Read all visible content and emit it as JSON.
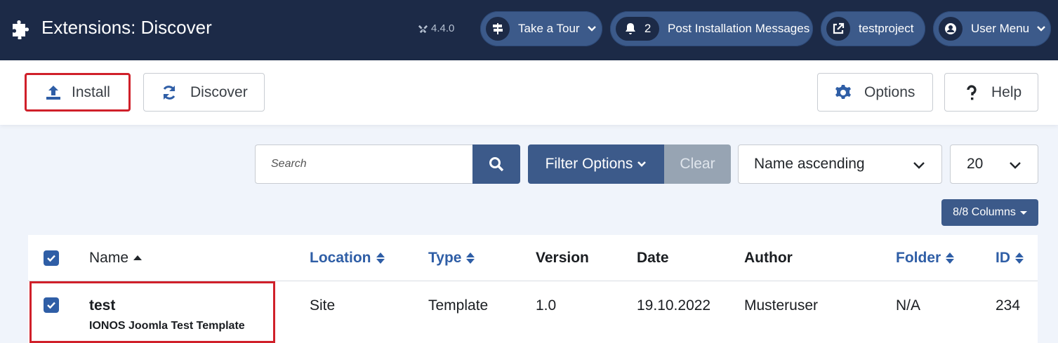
{
  "header": {
    "title": "Extensions: Discover",
    "version": "4.4.0",
    "tour_label": "Take a Tour",
    "notifications_count": "2",
    "post_install_label": "Post Installation Messages",
    "site_label": "testproject",
    "user_menu_label": "User Menu"
  },
  "toolbar": {
    "install_label": "Install",
    "discover_label": "Discover",
    "options_label": "Options",
    "help_label": "Help"
  },
  "filters": {
    "search_placeholder": "Search",
    "filter_options_label": "Filter Options",
    "clear_label": "Clear",
    "sort_selected": "Name ascending",
    "limit_selected": "20",
    "columns_label": "8/8 Columns"
  },
  "table": {
    "headers": {
      "name": "Name",
      "location": "Location",
      "type": "Type",
      "version": "Version",
      "date": "Date",
      "author": "Author",
      "folder": "Folder",
      "id": "ID"
    },
    "rows": [
      {
        "name": "test",
        "description": "IONOS Joomla Test Template",
        "location": "Site",
        "type": "Template",
        "version": "1.0",
        "date": "19.10.2022",
        "author": "Musteruser",
        "folder": "N/A",
        "id": "234"
      }
    ]
  },
  "colors": {
    "header_bg": "#1c2a47",
    "primary": "#3c5a8a",
    "link": "#2f5ea6",
    "highlight": "#d0202a"
  }
}
